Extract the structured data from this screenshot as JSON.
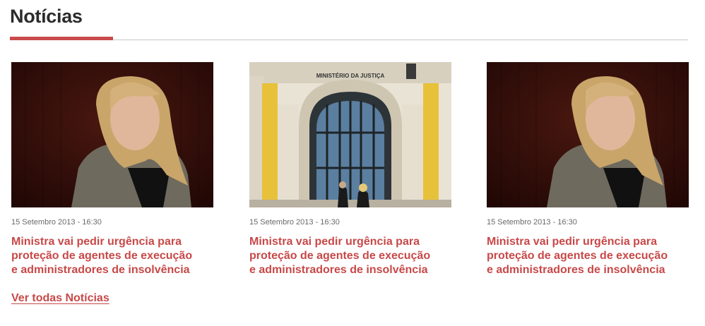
{
  "section": {
    "title": "Notícias"
  },
  "news": [
    {
      "image": "minister-portrait",
      "date": "15 Setembro 2013 - 16:30",
      "title_lines": [
        "Ministra vai pedir urgência para",
        "proteção de agentes de execução",
        "e administradores de insolvência"
      ]
    },
    {
      "image": "ministry-of-justice-facade",
      "image_sign": "MINISTÉRIO DA JUSTIÇA",
      "date": "15 Setembro 2013 - 16:30",
      "title_lines": [
        "Ministra vai pedir urgência para",
        "proteção de agentes de execução",
        "e administradores de insolvência"
      ]
    },
    {
      "image": "minister-portrait",
      "date": "15 Setembro 2013 - 16:30",
      "title_lines": [
        "Ministra vai pedir urgência para",
        "proteção de agentes de execução",
        "e administradores de insolvência"
      ]
    }
  ],
  "see_all_link": "Ver todas Notícias",
  "colors": {
    "accent": "#c94a4a",
    "link": "#c84848",
    "title": "#2b2b2b",
    "meta": "#6a6a6a"
  }
}
